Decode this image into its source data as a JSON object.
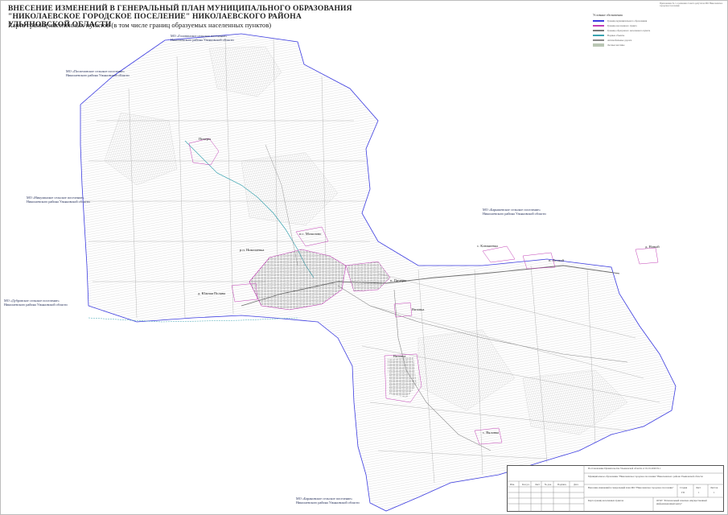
{
  "title": {
    "line1": "ВНЕСЕНИЕ ИЗМЕНЕНИЙ В ГЕНЕРАЛЬНЫЙ ПЛАН МУНИЦИПАЛЬНОГО ОБРАЗОВАНИЯ",
    "line2": "\"НИКОЛАЕВСКОЕ ГОРОДСКОЕ ПОСЕЛЕНИЕ\" НИКОЛАЕВСКОГО РАЙОНА УЛЬЯНОВСКОЙ ОБЛАСТИ",
    "subtitle": "Карта границ населенных пунктов (в том числе границ образуемых населенных пунктов)"
  },
  "neighbors": [
    {
      "id": "topcenter",
      "line1": "МО «Головинское сельское поселение»",
      "line2": "Николаевского района Ульяновской области"
    },
    {
      "id": "topleft",
      "line1": "МО «Поспеловское сельское поселение»",
      "line2": "Николаевского района Ульяновской области"
    },
    {
      "id": "left",
      "line1": "МО «Никулинское сельское поселение»",
      "line2": "Николаевского района Ульяновской области"
    },
    {
      "id": "lowleft",
      "line1": "МО «Дубровское сельское поселение»",
      "line2": "Николаевского района Ульяновской области"
    },
    {
      "id": "right",
      "line1": "МО «Барышевское сельское поселение»",
      "line2": "Николаевского района Ульяновской области"
    },
    {
      "id": "bottom",
      "line1": "МО «Барановское сельское поселение»",
      "line2": "Николаевского района Ульяновской области"
    }
  ],
  "places": {
    "p1": "Пичеры",
    "p2": "п.с. Мочилово",
    "p3": "р.п. Николаевка",
    "p4": "д. Южная Поляна",
    "p5": "п. Пичеры",
    "p6": "Вязовка",
    "p7": "Вязовка",
    "p8": "с. Клюкиевка",
    "p9": "п. Лесной",
    "p10": "д. Новый",
    "p11": "с. Вяловка"
  },
  "legend": {
    "header": "Условные обозначения",
    "items": [
      {
        "text": "Граница муниципального образования",
        "color": "#3b3be0"
      },
      {
        "text": "Граница населенного пункта",
        "color": "#c23fb5"
      },
      {
        "text": "Граница образуемого населенного пункта",
        "color": "#7a7a7a"
      },
      {
        "text": "Водные объекты",
        "color": "#3aa3b0"
      },
      {
        "text": "Автомобильные дороги",
        "color": "#8a8a8a"
      },
      {
        "text": "Лесные массивы",
        "color": "#b9c6b4"
      }
    ]
  },
  "topnote": "Приложение № 1 к решению Совета депутатов МО Николаевское городское поселение",
  "stamp": {
    "org": "Постановление Правительства Ульяновской области от 01.01.2020 № 1",
    "mo": "Муниципальное образование \"Николаевское городское поселение\" Николаевского района Ульяновской области",
    "project": "Внесение изменений в генеральный план МО \"Николаевское городское поселение\"",
    "sheet_title": "Карта границ населенных пунктов",
    "developer": "ОГКУ \"Региональный земельно-имущественный информационный центр\"",
    "stage_label": "Стадия",
    "sheet_label": "Лист",
    "sheets_label": "Листов",
    "stage": "ГП",
    "sheet": "1",
    "sheets": "1",
    "cols": [
      "Изм.",
      "Кол.уч.",
      "Лист",
      "№ док.",
      "Подпись",
      "Дата"
    ]
  },
  "colors": {
    "boundary_mo": "#3b3be0",
    "boundary_np": "#c23fb5",
    "river": "#3aa3b0",
    "road": "#8a8a8a",
    "hatch": "#b8b8b8"
  }
}
